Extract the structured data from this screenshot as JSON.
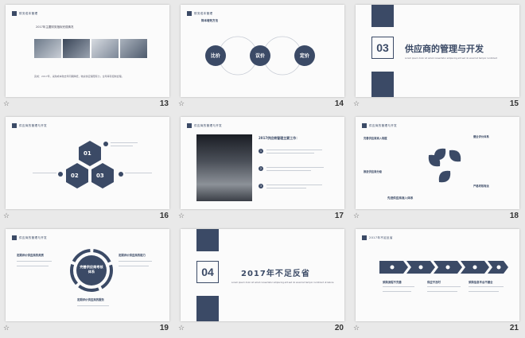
{
  "slides": [
    {
      "number": "13",
      "header": "财务成本管理",
      "title": "2017年主要财务指标完成情况",
      "body": "完成：2017年，采购成本较去年同期降低，物资供应保障有力，全年库存控制合理。"
    },
    {
      "number": "14",
      "header": "财务成本管理",
      "title": "降本增效方法",
      "circles": [
        "比价",
        "议价",
        "定价"
      ]
    },
    {
      "number": "15",
      "section_num": "03",
      "section_title": "供应商的管理与开发",
      "subtitle": "Lorem ipsum dolor sit amet consectetur adipiscing elit sed do eiusmod tempor incididunt"
    },
    {
      "number": "16",
      "header": "供应商的管理与开发",
      "hexes": [
        "01",
        "02",
        "03"
      ]
    },
    {
      "number": "17",
      "header": "供应商的管理与开发",
      "title": "2017供应商管理主要工作：",
      "steps": [
        "1",
        "2",
        "3"
      ]
    },
    {
      "number": "18",
      "header": "供应商的管理与开发",
      "labels": [
        "完善供应商准入制度",
        "健全评价体系",
        "推进供应商分级",
        "严格考核淘汰"
      ],
      "center_label": "先进供应商准入体系"
    },
    {
      "number": "19",
      "header": "供应商的管理与开发",
      "center": "完善供应商考核体系",
      "left_title": "定期评价供应商的资质",
      "right_title": "定期评价供应商的能力",
      "bottom_title": "定期评价供应商的服务"
    },
    {
      "number": "20",
      "section_num": "04",
      "section_title": "2017年不足反省",
      "subtitle": "Lorem ipsum dolor sit amet consectetur adipiscing elit sed do eiusmod tempor incididunt ut labore"
    },
    {
      "number": "21",
      "header": "2017年不足反省",
      "items": [
        "采购流程不完善",
        "供应不及时",
        "采购信息平台不健全"
      ]
    }
  ],
  "star_icon": "☆"
}
